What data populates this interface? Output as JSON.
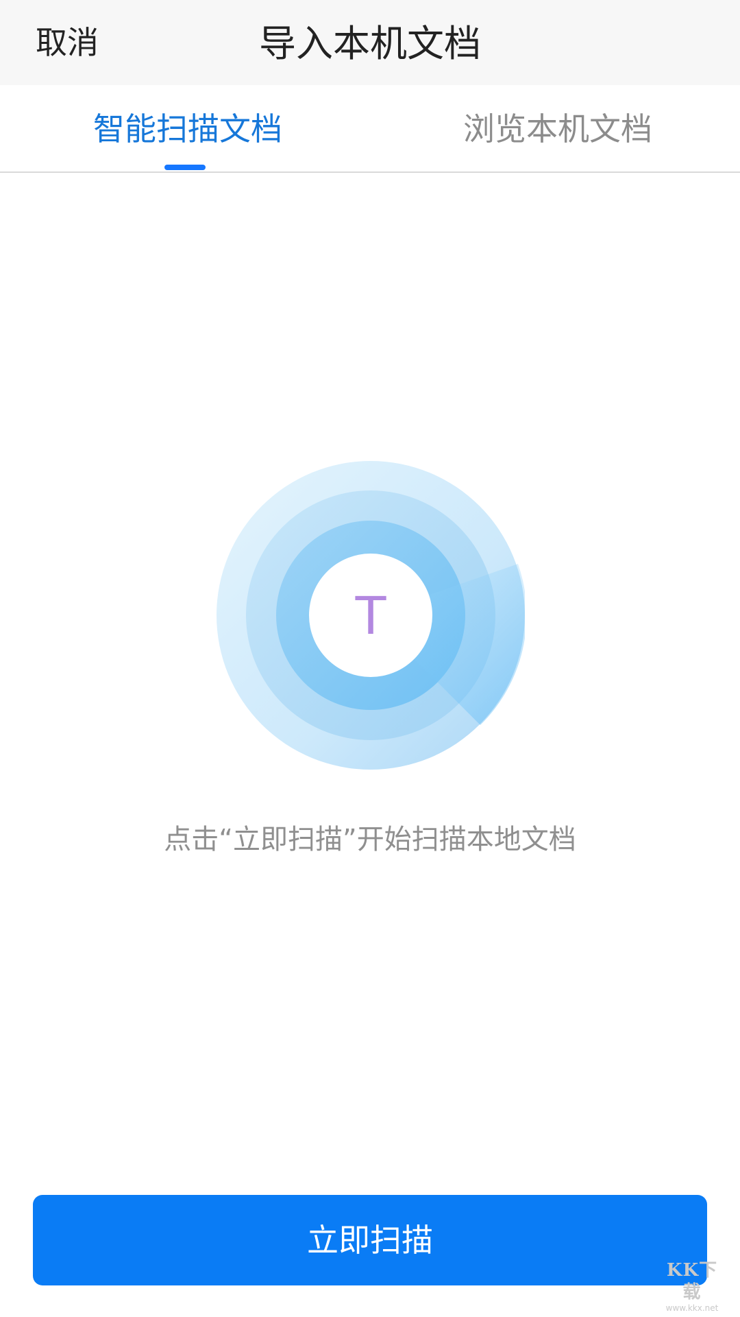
{
  "header": {
    "cancel_label": "取消",
    "title": "导入本机文档"
  },
  "tabs": [
    {
      "label": "智能扫描文档",
      "active": true
    },
    {
      "label": "浏览本机文档",
      "active": false
    }
  ],
  "scan": {
    "center_letter": "T",
    "hint": "点击“立即扫描”开始扫描本地文档"
  },
  "primary_button": {
    "label": "立即扫描"
  },
  "watermark": {
    "logo_text": "KK下载",
    "url": "www.kkx.net"
  },
  "colors": {
    "accent": "#0a7cf5",
    "active_tab_text": "#1677d9",
    "inactive_tab_text": "#8c8c8c",
    "scan_letter": "#b388e0",
    "ring_outer": "#d6eefc",
    "ring_middle": "#b5dcf7",
    "ring_inner": "#8ccaf2"
  }
}
